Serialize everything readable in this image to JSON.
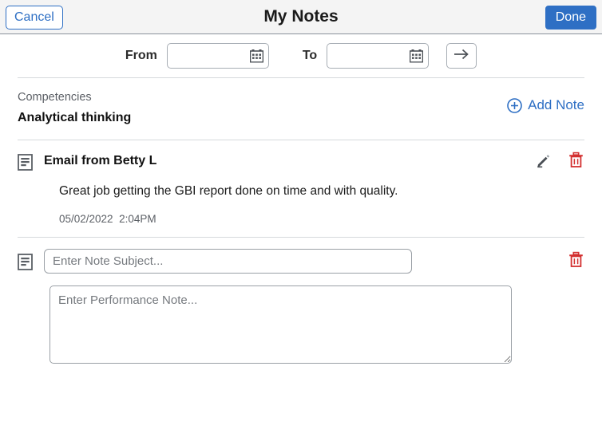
{
  "header": {
    "cancel_label": "Cancel",
    "title": "My Notes",
    "done_label": "Done",
    "accent_color": "#2e6fc4"
  },
  "filter": {
    "from_label": "From",
    "from_value": "",
    "from_placeholder": "",
    "to_label": "To",
    "to_value": "",
    "to_placeholder": "",
    "calendar_icon": "calendar-icon",
    "go_icon": "arrow-right-icon"
  },
  "competency": {
    "section_label": "Competencies",
    "name": "Analytical thinking",
    "add_note_label": "Add Note",
    "add_note_icon": "plus-circle-icon"
  },
  "notes": [
    {
      "icon": "note-document-icon",
      "title": "Email from Betty L",
      "body": "Great job getting the GBI report done on time and with quality.",
      "date": "05/02/2022",
      "time": "2:04PM",
      "edit_icon": "pencil-icon",
      "delete_icon": "trash-icon"
    }
  ],
  "new_note": {
    "icon": "note-document-icon",
    "subject_value": "",
    "subject_placeholder": "Enter Note Subject...",
    "body_value": "",
    "body_placeholder": "Enter Performance Note...",
    "delete_icon": "trash-icon",
    "delete_color": "#d32f2f"
  }
}
